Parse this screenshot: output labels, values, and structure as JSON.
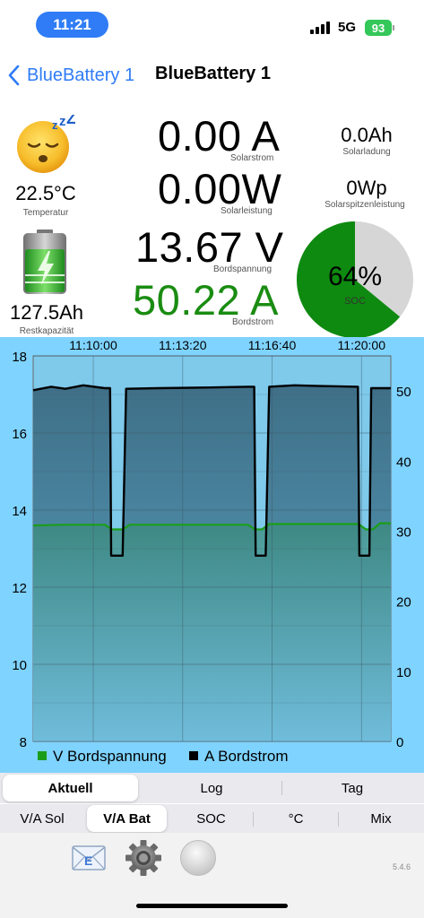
{
  "status_bar": {
    "time": "11:21",
    "network": "5G",
    "battery": "93"
  },
  "nav": {
    "back_label": "BlueBattery 1",
    "title": "BlueBattery 1"
  },
  "left": {
    "face_icon": "sleeping-face-emoji",
    "temperature": "22.5°C",
    "temperature_label": "Temperatur",
    "battery_icon": "charging-battery-icon",
    "rest_capacity": "127.5Ah",
    "rest_capacity_label": "Restkapazität"
  },
  "center": {
    "solar_current": "0.00 A",
    "solar_current_label": "Solarstrom",
    "solar_power": "0.00W",
    "solar_power_label": "Solarleistung",
    "board_voltage": "13.67 V",
    "board_voltage_label": "Bordspannung",
    "board_current": "50.22 A",
    "board_current_label": "Bordstrom",
    "board_current_color": "#1a8c12"
  },
  "right": {
    "solar_charge": "0.0Ah",
    "solar_charge_label": "Solarladung",
    "solar_peak": "0Wp",
    "solar_peak_label": "Solarspitzenleistung",
    "soc_percent": 64,
    "soc_text": "64%",
    "soc_label": "SOC",
    "soc_color": "#0e8a10",
    "soc_rest_color": "#d6d6d6"
  },
  "chart_data": {
    "type": "line",
    "x_ticks": [
      "11:10:00",
      "11:13:20",
      "11:16:40",
      "11:20:00"
    ],
    "y_left_ticks": [
      "18",
      "16",
      "14",
      "12",
      "10",
      "8"
    ],
    "y_right_ticks": [
      "50",
      "40",
      "30",
      "20",
      "10",
      "0"
    ],
    "y_left_range": [
      8,
      18
    ],
    "y_right_range": [
      0,
      55
    ],
    "grid": true,
    "legend_position": "bottom",
    "series": [
      {
        "name": "V Bordspannung",
        "axis": "left",
        "color": "#1a9e1a",
        "points": [
          [
            0,
            13.6
          ],
          [
            0.09,
            13.62
          ],
          [
            0.2,
            13.62
          ],
          [
            0.22,
            13.5
          ],
          [
            0.25,
            13.5
          ],
          [
            0.27,
            13.62
          ],
          [
            0.6,
            13.62
          ],
          [
            0.62,
            13.5
          ],
          [
            0.64,
            13.5
          ],
          [
            0.66,
            13.64
          ],
          [
            0.91,
            13.64
          ],
          [
            0.93,
            13.5
          ],
          [
            0.95,
            13.5
          ],
          [
            0.97,
            13.66
          ],
          [
            1,
            13.66
          ]
        ]
      },
      {
        "name": "A Bordstrom",
        "axis": "right",
        "color": "#000000",
        "points": [
          [
            0,
            50.1
          ],
          [
            0.05,
            50.6
          ],
          [
            0.09,
            50.3
          ],
          [
            0.14,
            50.8
          ],
          [
            0.2,
            50.4
          ],
          [
            0.215,
            50.4
          ],
          [
            0.218,
            26.5
          ],
          [
            0.25,
            26.5
          ],
          [
            0.26,
            50.3
          ],
          [
            0.35,
            50.4
          ],
          [
            0.5,
            50.5
          ],
          [
            0.6,
            50.6
          ],
          [
            0.618,
            50.6
          ],
          [
            0.622,
            26.5
          ],
          [
            0.65,
            26.5
          ],
          [
            0.66,
            50.6
          ],
          [
            0.73,
            50.8
          ],
          [
            0.8,
            50.7
          ],
          [
            0.908,
            50.6
          ],
          [
            0.912,
            26.5
          ],
          [
            0.94,
            26.5
          ],
          [
            0.945,
            50.4
          ],
          [
            1,
            50.4
          ]
        ]
      }
    ],
    "legend": [
      {
        "label": "V Bordspannung",
        "color": "#1a9e1a"
      },
      {
        "label": "A Bordstrom",
        "color": "#000000"
      }
    ]
  },
  "tabs": {
    "row1": [
      {
        "label": "Aktuell",
        "selected": true
      },
      {
        "label": "Log",
        "selected": false
      },
      {
        "label": "Tag",
        "selected": false
      }
    ],
    "row2": [
      {
        "label": "V/A Sol",
        "selected": false
      },
      {
        "label": "V/A Bat",
        "selected": true
      },
      {
        "label": "SOC",
        "selected": false
      },
      {
        "label": "°C",
        "selected": false
      },
      {
        "label": "Mix",
        "selected": false
      }
    ]
  },
  "toolbar": {
    "mail_icon": "email-icon",
    "mail_letter": "E",
    "settings_icon": "gear-icon",
    "record_icon": "record-button-icon",
    "version": "5.4.6"
  }
}
